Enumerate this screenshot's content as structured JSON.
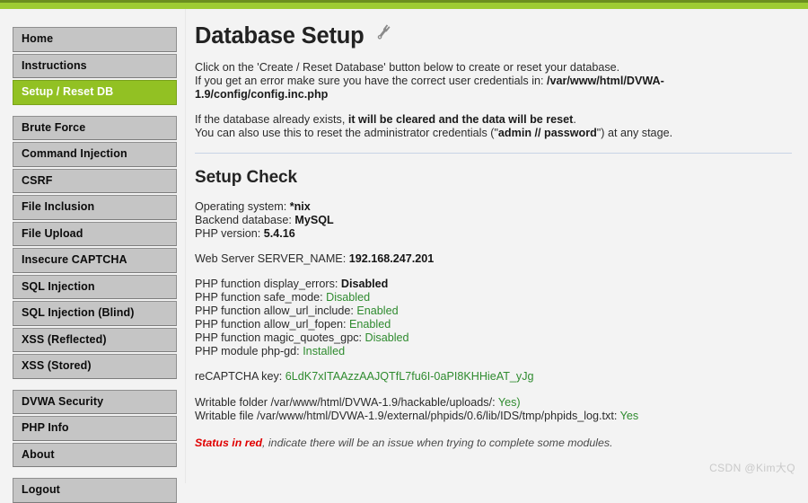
{
  "theme": {
    "accent_green": "#92c123",
    "topbar_green": "#9dcc33",
    "topbar_border": "#6b8f1f",
    "nav_gray": "#c5c5c5",
    "page_bg": "#f3f3f3",
    "ok_green": "#2f8b2f",
    "error_red": "#e00000",
    "rule_blue": "#c8d4e6"
  },
  "sidebar": {
    "groups": [
      {
        "items": [
          {
            "label": "Home",
            "active": false
          },
          {
            "label": "Instructions",
            "active": false
          },
          {
            "label": "Setup / Reset DB",
            "active": true
          }
        ]
      },
      {
        "items": [
          {
            "label": "Brute Force",
            "active": false
          },
          {
            "label": "Command Injection",
            "active": false
          },
          {
            "label": "CSRF",
            "active": false
          },
          {
            "label": "File Inclusion",
            "active": false
          },
          {
            "label": "File Upload",
            "active": false
          },
          {
            "label": "Insecure CAPTCHA",
            "active": false
          },
          {
            "label": "SQL Injection",
            "active": false
          },
          {
            "label": "SQL Injection (Blind)",
            "active": false
          },
          {
            "label": "XSS (Reflected)",
            "active": false
          },
          {
            "label": "XSS (Stored)",
            "active": false
          }
        ]
      },
      {
        "items": [
          {
            "label": "DVWA Security",
            "active": false
          },
          {
            "label": "PHP Info",
            "active": false
          },
          {
            "label": "About",
            "active": false
          }
        ]
      },
      {
        "items": [
          {
            "label": "Logout",
            "active": false
          }
        ]
      }
    ]
  },
  "main": {
    "title": "Database Setup",
    "title_icon": "wrench-icon",
    "intro": {
      "line1": "Click on the 'Create / Reset Database' button below to create or reset your database.",
      "line2_prefix": "If you get an error make sure you have the correct user credentials in: ",
      "line2_path": "/var/www/html/DVWA-1.9/config/config.inc.php",
      "line3_prefix": "If the database already exists, ",
      "line3_bold": "it will be cleared and the data will be reset",
      "line3_suffix": ".",
      "line4_prefix": "You can also use this to reset the administrator credentials (\"",
      "line4_bold": "admin // password",
      "line4_suffix": "\") at any stage."
    },
    "setup_check": {
      "title": "Setup Check",
      "system": [
        {
          "label": "Operating system: ",
          "value": "*nix",
          "style": "bold"
        },
        {
          "label": "Backend database: ",
          "value": "MySQL",
          "style": "bold"
        },
        {
          "label": "PHP version: ",
          "value": "5.4.16",
          "style": "bold"
        }
      ],
      "server": [
        {
          "label": "Web Server SERVER_NAME: ",
          "value": "192.168.247.201",
          "style": "bold"
        }
      ],
      "php_settings": [
        {
          "label": "PHP function display_errors: ",
          "value": "Disabled",
          "style": "bold"
        },
        {
          "label": "PHP function safe_mode: ",
          "value": "Disabled",
          "style": "green"
        },
        {
          "label": "PHP function allow_url_include: ",
          "value": "Enabled",
          "style": "green"
        },
        {
          "label": "PHP function allow_url_fopen: ",
          "value": "Enabled",
          "style": "green"
        },
        {
          "label": "PHP function magic_quotes_gpc: ",
          "value": "Disabled",
          "style": "green"
        },
        {
          "label": "PHP module php-gd: ",
          "value": "Installed",
          "style": "green"
        }
      ],
      "recaptcha": [
        {
          "label": "reCAPTCHA key: ",
          "value": "6LdK7xITAAzzAAJQTfL7fu6I-0aPI8KHHieAT_yJg",
          "style": "green"
        }
      ],
      "writable": [
        {
          "label": "Writable folder /var/www/html/DVWA-1.9/hackable/uploads/: ",
          "value": "Yes)",
          "style": "green"
        },
        {
          "label": "Writable file /var/www/html/DVWA-1.9/external/phpids/0.6/lib/IDS/tmp/phpids_log.txt: ",
          "value": "Yes",
          "style": "green"
        }
      ],
      "note_red": "Status in red",
      "note_rest": ", indicate there will be an issue when trying to complete some modules."
    }
  },
  "watermark": "CSDN @Kim大Q"
}
